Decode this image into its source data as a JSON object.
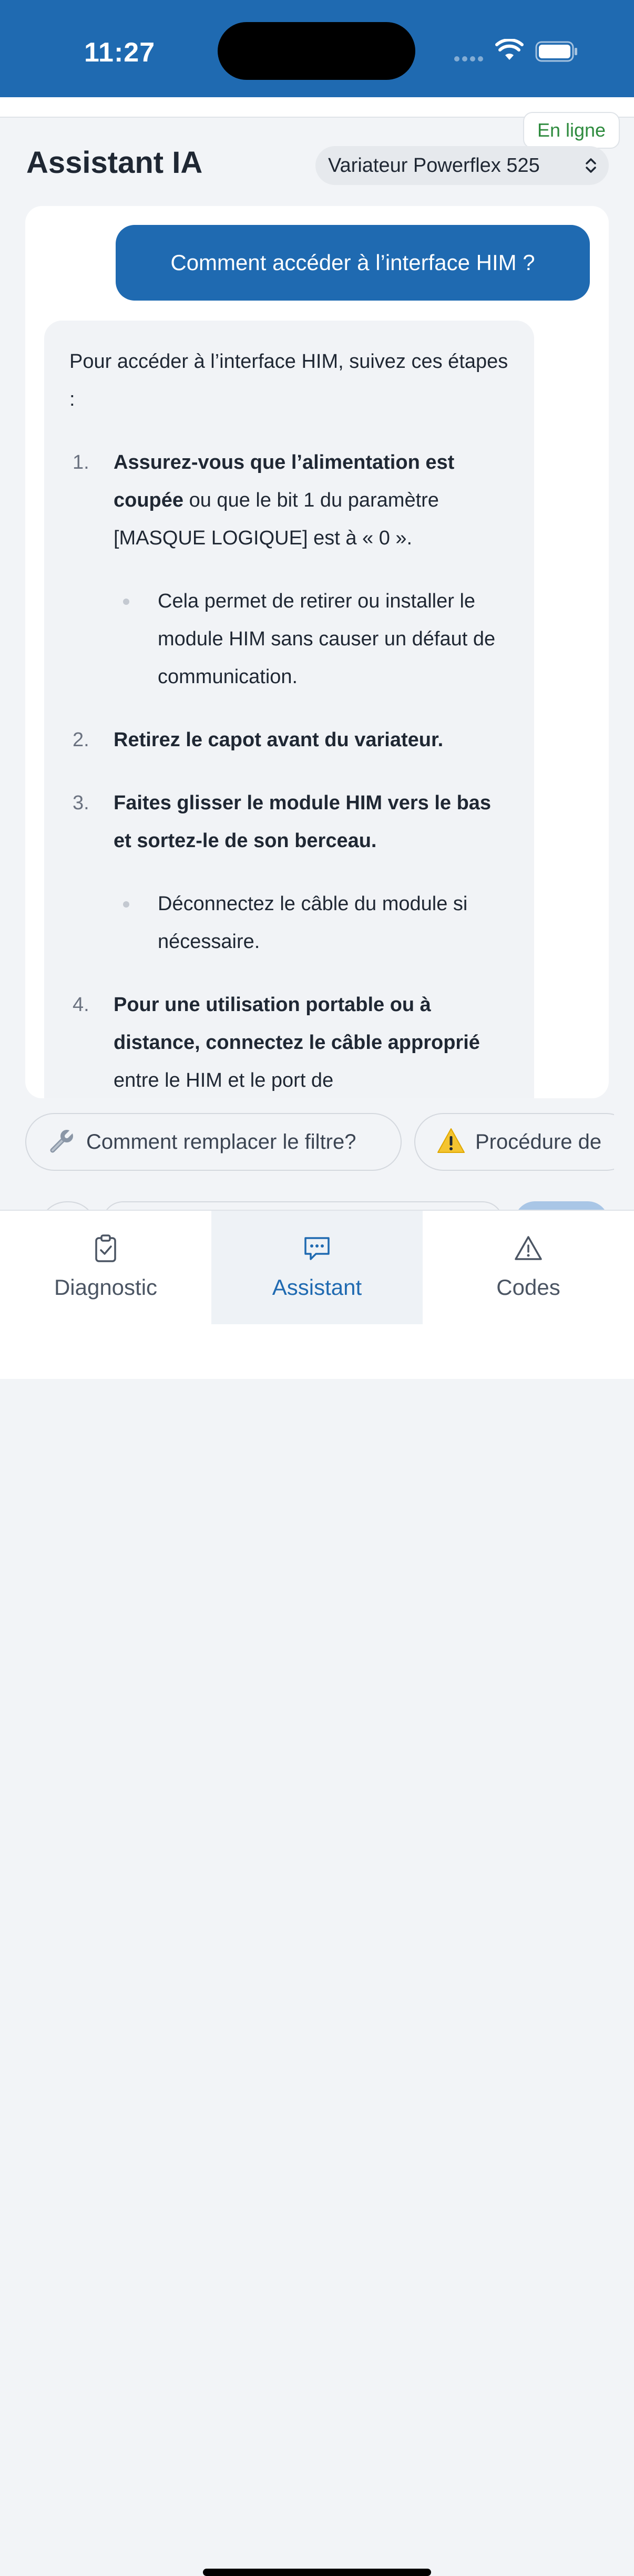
{
  "status_bar": {
    "time": "11:27"
  },
  "header": {
    "online_badge": "En ligne",
    "title": "Assistant IA",
    "device_select": "Variateur Powerflex 525"
  },
  "chat": {
    "user_message": "Comment accéder à l’interface HIM ?",
    "assistant": {
      "intro": "Pour accéder à l’interface HIM, suivez ces étapes :",
      "steps": [
        {
          "number": "1.",
          "bold": "Assurez-vous que l’alimentation est coupée",
          "rest": " ou que le bit 1 du paramètre [MASQUE LOGIQUE] est à « 0 ».",
          "sub": "Cela permet de retirer ou installer le module HIM sans causer un défaut de communication."
        },
        {
          "number": "2.",
          "bold": "Retirez le capot avant du variateur.",
          "rest": ""
        },
        {
          "number": "3.",
          "bold": "Faites glisser le module HIM vers le bas et sortez-le de son berceau.",
          "rest": "",
          "sub": "Déconnectez le câble du module si nécessaire."
        },
        {
          "number": "4.",
          "bold": "Pour une utilisation portable ou à distance, connectez le câble approprié",
          "rest": " entre le HIM et le port de"
        }
      ]
    }
  },
  "suggestions": [
    {
      "icon": "wrench-icon",
      "label": "Comment remplacer le filtre?"
    },
    {
      "icon": "warning-icon",
      "label": "Procédure de"
    }
  ],
  "tabs": [
    {
      "id": "diagnostic",
      "icon": "clipboard-check-icon",
      "label": "Diagnostic"
    },
    {
      "id": "assistant",
      "icon": "chat-bubble-icon",
      "label": "Assistant",
      "active": true
    },
    {
      "id": "codes",
      "icon": "warning-triangle-icon",
      "label": "Codes"
    }
  ],
  "colors": {
    "primary": "#1f6ab1",
    "online": "#2e8b3e",
    "bubble_bg": "#f1f3f6",
    "page_bg": "#f2f4f7"
  }
}
